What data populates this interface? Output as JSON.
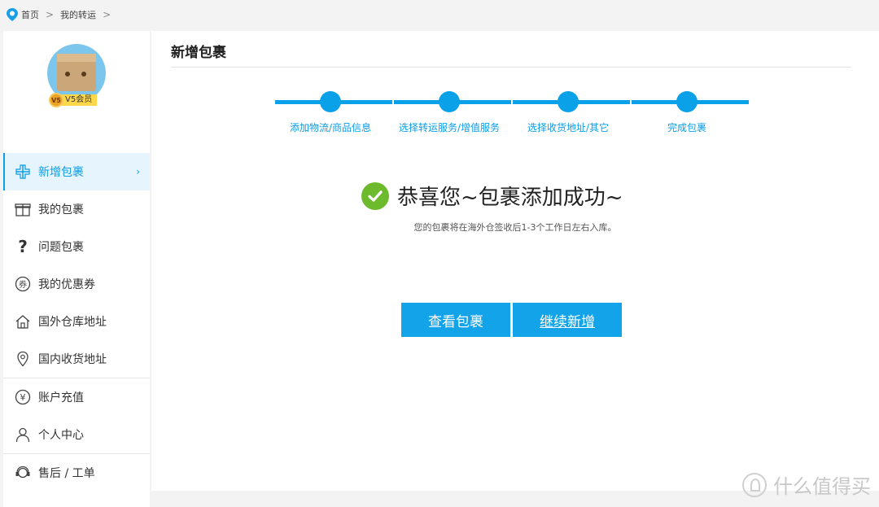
{
  "breadcrumb": {
    "home": "首页",
    "current": "我的转运"
  },
  "user": {
    "vip_level": "V5",
    "vip_label": "V5会员"
  },
  "sidebar": {
    "items": [
      {
        "label": "新增包裹",
        "icon": "plus-icon",
        "active": true
      },
      {
        "label": "我的包裹",
        "icon": "gift-icon"
      },
      {
        "label": "问题包裹",
        "icon": "question-icon"
      },
      {
        "label": "我的优惠券",
        "icon": "coupon-icon"
      },
      {
        "label": "国外仓库地址",
        "icon": "house-icon"
      },
      {
        "label": "国内收货地址",
        "icon": "location-pin-icon"
      },
      {
        "label": "账户充值",
        "icon": "yen-icon"
      },
      {
        "label": "个人中心",
        "icon": "user-icon"
      },
      {
        "label": "售后 / 工单",
        "icon": "headset-icon"
      }
    ]
  },
  "main": {
    "title": "新增包裹",
    "steps": [
      "添加物流/商品信息",
      "选择转运服务/增值服务",
      "选择收货地址/其它",
      "完成包裹"
    ],
    "success_title": "恭喜您~包裹添加成功~",
    "success_sub": "您的包裹将在海外仓签收后1-3个工作日左右入库。",
    "buttons": {
      "view": "查看包裹",
      "continue": "继续新增"
    }
  },
  "watermark": "什么值得买",
  "colors": {
    "accent": "#0aa1e9",
    "success": "#6dbb2c",
    "vip_badge": "#ffd84a"
  }
}
